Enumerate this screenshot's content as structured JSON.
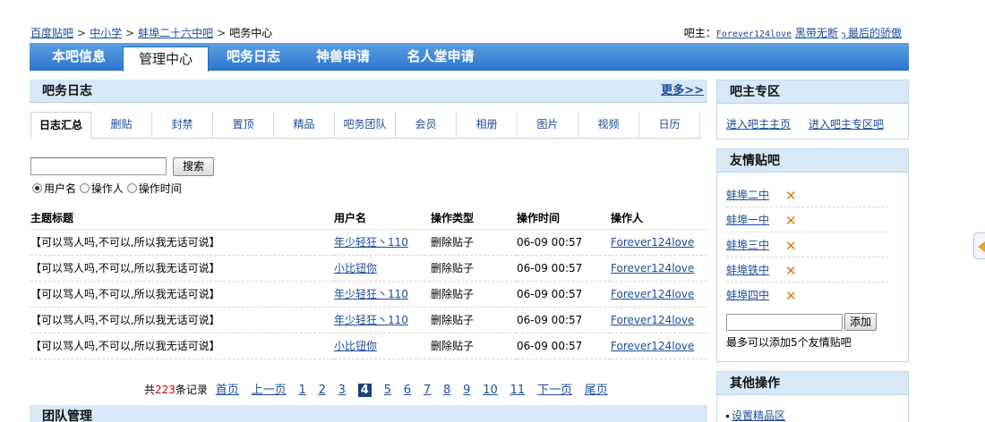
{
  "breadcrumb": {
    "items": [
      "百度贴吧",
      "中小学",
      "蚌埠二十六中吧"
    ],
    "current": "吧务中心",
    "separator": ">"
  },
  "managers": {
    "label": "吧主：",
    "names": [
      "Forever124love",
      "黑带无断",
      "╮最后的骄傲"
    ]
  },
  "nav": {
    "tabs": [
      "本吧信息",
      "管理中心",
      "吧务日志",
      "神兽申请",
      "名人堂申请"
    ],
    "active": "管理中心"
  },
  "main": {
    "title": "吧务日志",
    "more": "更多>>",
    "subtabs": [
      "日志汇总",
      "删贴",
      "封禁",
      "置顶",
      "精品",
      "吧务团队",
      "会员",
      "相册",
      "图片",
      "视频",
      "日历"
    ],
    "active_subtab": "日志汇总",
    "search": {
      "value": "",
      "button": "搜索",
      "options": [
        "用户名",
        "操作人",
        "操作时间"
      ],
      "selected": "用户名"
    },
    "table": {
      "headers": [
        "主题标题",
        "用户名",
        "操作类型",
        "操作时间",
        "操作人"
      ],
      "rows": [
        [
          "【可以骂人吗,不可以,所以我无话可说】",
          "年少轻狂丶110",
          "删除贴子",
          "06-09 00:57",
          "Forever124love"
        ],
        [
          "【可以骂人吗,不可以,所以我无话可说】",
          "小比钮你",
          "删除贴子",
          "06-09 00:57",
          "Forever124love"
        ],
        [
          "【可以骂人吗,不可以,所以我无话可说】",
          "年少轻狂丶110",
          "删除贴子",
          "06-09 00:57",
          "Forever124love"
        ],
        [
          "【可以骂人吗,不可以,所以我无话可说】",
          "年少轻狂丶110",
          "删除贴子",
          "06-09 00:57",
          "Forever124love"
        ],
        [
          "【可以骂人吗,不可以,所以我无话可说】",
          "小比钮你",
          "删除贴子",
          "06-09 00:57",
          "Forever124love"
        ]
      ]
    },
    "pager": {
      "prefix": "共",
      "total": "223",
      "suffix": "条记录",
      "first": "首页",
      "prev": "上一页",
      "pages": [
        "1",
        "2",
        "3",
        "4",
        "5",
        "6",
        "7",
        "8",
        "9",
        "10",
        "11"
      ],
      "current": "4",
      "next": "下一页",
      "last": "尾页"
    },
    "team_title": "团队管理"
  },
  "side": {
    "owner_zone": {
      "title": "吧主专区",
      "links": [
        "进入吧主主页",
        "进入吧主专区吧"
      ]
    },
    "friends": {
      "title": "友情贴吧",
      "items": [
        "蚌埠二中",
        "蚌埠一中",
        "蚌埠三中",
        "蚌埠铁中",
        "蚌埠四中"
      ],
      "input_value": "",
      "add_button": "添加",
      "hint": "最多可以添加5个友情贴吧"
    },
    "other": {
      "title": "其他操作",
      "items": [
        "设置精品区"
      ]
    }
  },
  "colors": {
    "nav_bar": "#3b86d8",
    "panel_head": "#d9e8f6",
    "link": "#1a4c9c",
    "current_page": "#1a3f7a",
    "delete_icon": "#d9761a"
  }
}
